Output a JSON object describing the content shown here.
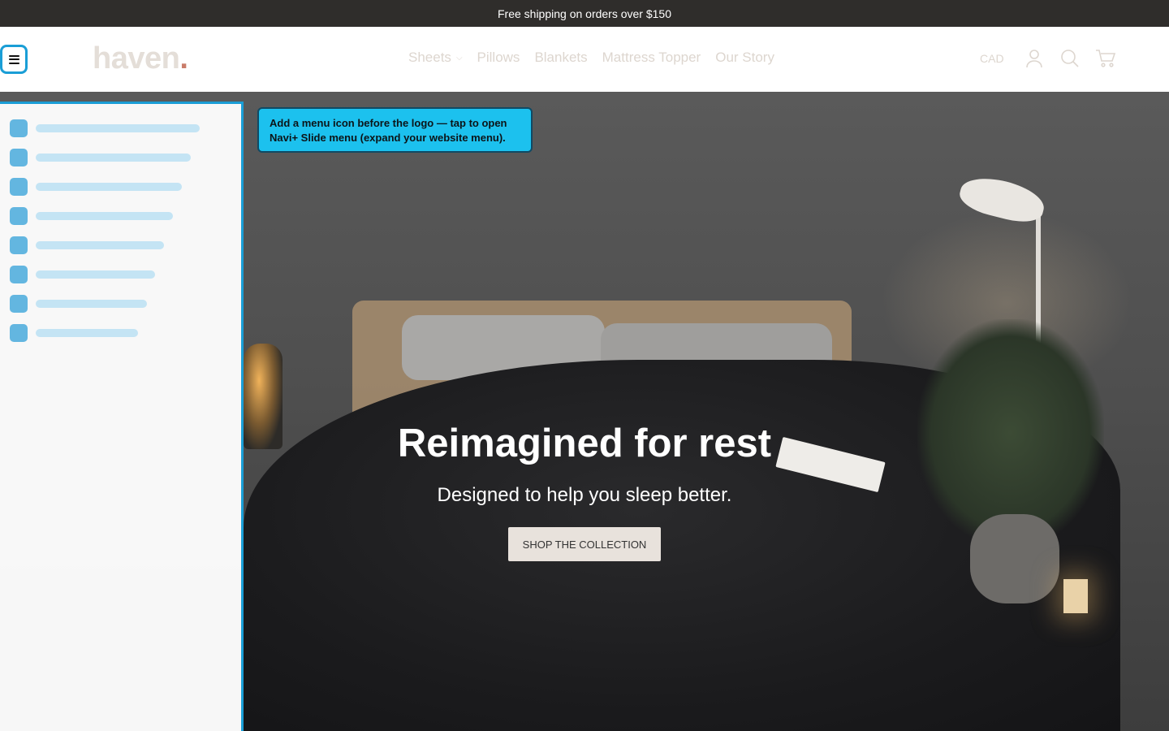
{
  "announcement": "Free shipping on orders over $150",
  "header": {
    "logo_text": "haven",
    "logo_dot": ".",
    "nav": [
      {
        "label": "Sheets",
        "has_dropdown": true
      },
      {
        "label": "Pillows"
      },
      {
        "label": "Blankets"
      },
      {
        "label": "Mattress Topper"
      },
      {
        "label": "Our Story"
      }
    ],
    "currency": "CAD",
    "icons": [
      "account-icon",
      "search-icon",
      "cart-icon"
    ]
  },
  "hero": {
    "title": "Reimagined for rest",
    "subtitle": "Designed to help you sleep better.",
    "cta": "SHOP THE COLLECTION"
  },
  "tooltip": {
    "line1": "Add a menu icon before the logo — tap to open",
    "line2": "Navi+ Slide menu (expand your website menu)."
  },
  "colors": {
    "accent": "#1a9ed6",
    "tooltip_bg": "#1cc1ee",
    "announcement_bg": "#2f2d2b",
    "logo_dot": "#c97c6a"
  }
}
